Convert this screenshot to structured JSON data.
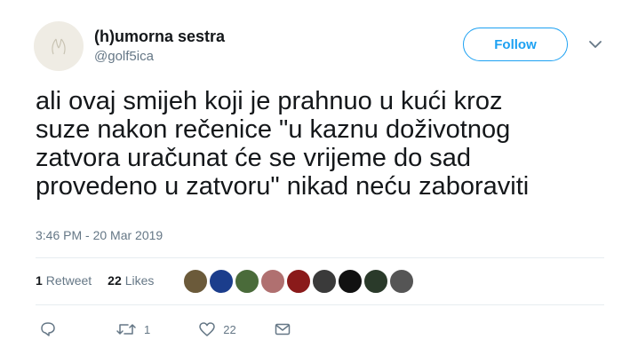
{
  "author": {
    "name": "(h)umorna sestra",
    "handle": "@golf5ica"
  },
  "follow_label": "Follow",
  "tweet": {
    "lines": [
      "ali ovaj smijeh koji je prahnuo u kući kroz",
      "suze nakon rečenice \"u kaznu doživotnog",
      "zatvora uračunat će se vrijeme do sad",
      "provedeno u zatvoru\" nikad neću zaboraviti"
    ],
    "timestamp": "3:46 PM - 20 Mar 2019"
  },
  "stats": {
    "retweet_count": "1",
    "retweet_label": "Retweet",
    "like_count": "22",
    "like_label": "Likes"
  },
  "actions": {
    "retweet_count": "1",
    "like_count": "22"
  },
  "colors": {
    "accent": "#1da1f2",
    "secondary_text": "#657786",
    "divider": "#e6ecf0"
  },
  "liker_avatars": [
    "#6b5a3a",
    "#1b3d8c",
    "#4a6b3a",
    "#b07070",
    "#8a1a1a",
    "#3a3a3a",
    "#111111",
    "#2a3a2a",
    "#555555"
  ]
}
